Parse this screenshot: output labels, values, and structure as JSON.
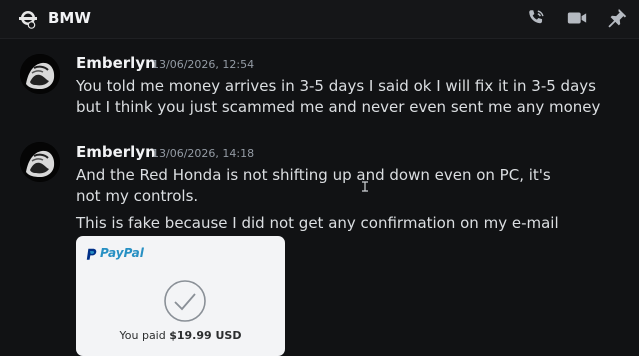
{
  "header": {
    "channel_name": "BMW",
    "icons": [
      "dm-avatar-icon",
      "voice-call-icon",
      "video-call-icon",
      "pin-icon"
    ]
  },
  "messages": [
    {
      "author": "Emberlyn",
      "timestamp": "13/06/2026, 12:54",
      "lines": [
        "You told me money arrives in 3-5 days I said ok I will fix it in 3-5 days but I think you just scammed me and never even sent me any money"
      ]
    },
    {
      "author": "Emberlyn",
      "timestamp": "13/06/2026, 14:18",
      "lines": [
        "And the Red Honda is not shifting up and down even on PC, it's not my controls.",
        "This is fake because I did not get any confirmation on my e-mail"
      ],
      "attachment": {
        "brand": "PayPal",
        "paid_prefix": "You paid",
        "amount": "$19.99 USD"
      }
    }
  ],
  "colors": {
    "background": "#111214",
    "text": "#dbdee1",
    "muted": "#949ba4",
    "paypal_blue": "#003087",
    "paypal_light": "#2790c3"
  }
}
